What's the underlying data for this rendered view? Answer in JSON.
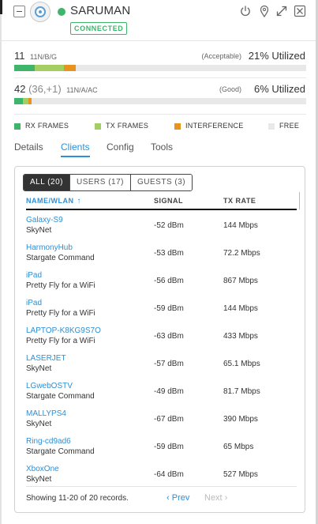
{
  "colors": {
    "accent": "#2d8fd5",
    "connected": "#3fb56b",
    "rx": "#3fb56b",
    "tx": "#a3cf62",
    "interference": "#e8931f",
    "free": "#e8e8e8"
  },
  "header": {
    "device_icon": "access-point-icon",
    "device_name": "SARUMAN",
    "status_badge": "CONNECTED",
    "icons": [
      "power-icon",
      "locate-icon",
      "expand-icon",
      "close-icon"
    ]
  },
  "radios": [
    {
      "channel": "11",
      "channel_extra": "",
      "standard": "11N/B/G",
      "quality": "(Acceptable)",
      "utilization": "21% Utilized",
      "rx_pct": 7,
      "tx_pct": 10,
      "interference_pct": 4
    },
    {
      "channel": "42",
      "channel_extra": "(36,+1)",
      "standard": "11N/A/AC",
      "quality": "(Good)",
      "utilization": "6% Utilized",
      "rx_pct": 3,
      "tx_pct": 2,
      "interference_pct": 1
    }
  ],
  "legend": {
    "rx": "RX FRAMES",
    "tx": "TX FRAMES",
    "interference": "INTERFERENCE",
    "free": "FREE"
  },
  "tabs": {
    "details": "Details",
    "clients": "Clients",
    "config": "Config",
    "tools": "Tools",
    "active": "clients"
  },
  "filters": {
    "all": "ALL (20)",
    "users": "USERS (17)",
    "guests": "GUESTS (3)"
  },
  "table": {
    "col_name": "NAME/WLAN",
    "col_signal": "SIGNAL",
    "col_rate": "TX RATE",
    "sort_icon": "sort-arrow-up-icon",
    "rows": [
      {
        "name": "Galaxy-S9",
        "ssid": "SkyNet",
        "signal": "-52 dBm",
        "rate": "144 Mbps"
      },
      {
        "name": "HarmonyHub",
        "ssid": "Stargate Command",
        "signal": "-53 dBm",
        "rate": "72.2 Mbps"
      },
      {
        "name": "iPad",
        "ssid": "Pretty Fly for a WiFi",
        "signal": "-56 dBm",
        "rate": "867 Mbps"
      },
      {
        "name": "iPad",
        "ssid": "Pretty Fly for a WiFi",
        "signal": "-59 dBm",
        "rate": "144 Mbps"
      },
      {
        "name": "LAPTOP-K8KG9S7O",
        "ssid": "Pretty Fly for a WiFi",
        "signal": "-63 dBm",
        "rate": "433 Mbps"
      },
      {
        "name": "LASERJET",
        "ssid": "SkyNet",
        "signal": "-57 dBm",
        "rate": "65.1 Mbps"
      },
      {
        "name": "LGwebOSTV",
        "ssid": "Stargate Command",
        "signal": "-49 dBm",
        "rate": "81.7 Mbps"
      },
      {
        "name": "MALLYPS4",
        "ssid": "SkyNet",
        "signal": "-67 dBm",
        "rate": "390 Mbps"
      },
      {
        "name": "Ring-cd9ad6",
        "ssid": "Stargate Command",
        "signal": "-59 dBm",
        "rate": "65 Mbps"
      },
      {
        "name": "XboxOne",
        "ssid": "SkyNet",
        "signal": "-64 dBm",
        "rate": "527 Mbps"
      }
    ]
  },
  "footer": {
    "summary": "Showing 11-20 of 20 records.",
    "prev": "Prev",
    "next": "Next"
  }
}
